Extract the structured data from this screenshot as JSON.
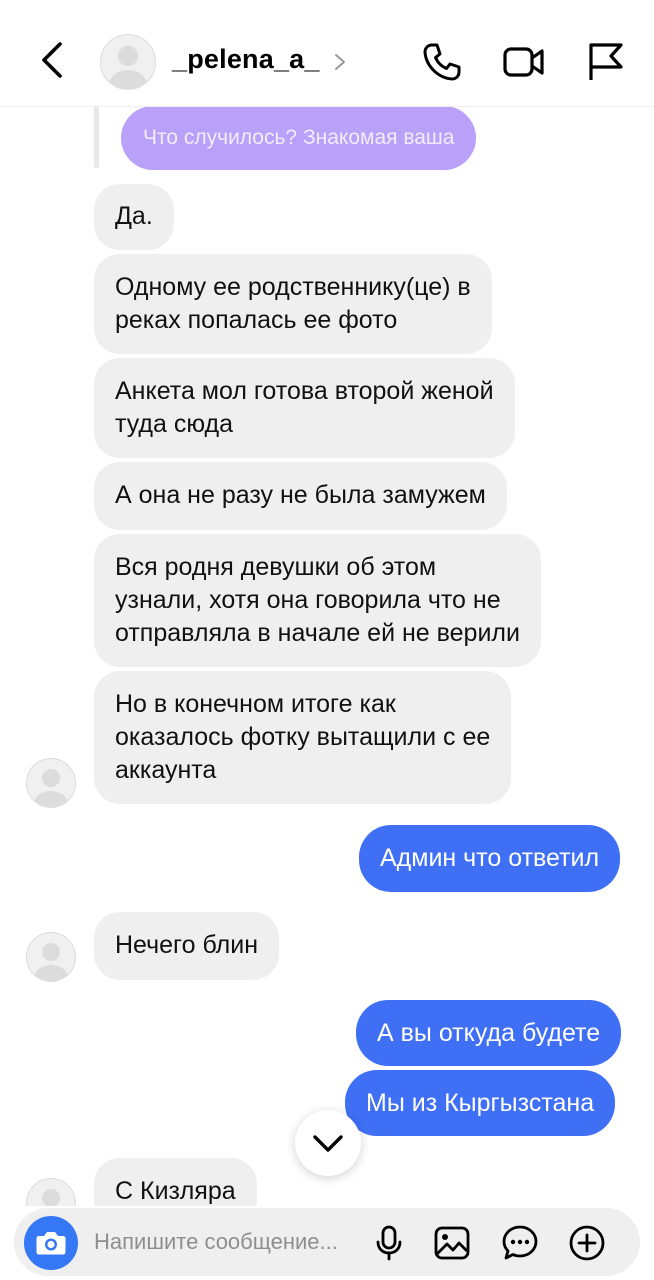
{
  "header": {
    "username": "_pelena_a_",
    "back_icon": "chevron-left-icon",
    "call_icon": "phone-icon",
    "video_icon": "video-camera-icon",
    "report_icon": "flag-icon"
  },
  "replied_message": "Что случилось? Знакомая ваша",
  "messages": [
    {
      "from": "them",
      "lines": [
        "Да."
      ]
    },
    {
      "from": "them",
      "lines": [
        "Одному ее родственнику(це) в",
        "реках попалась ее фото"
      ]
    },
    {
      "from": "them",
      "lines": [
        "Анкета мол готова второй женой",
        "туда сюда"
      ]
    },
    {
      "from": "them",
      "lines": [
        "А она не разу не была замужем"
      ]
    },
    {
      "from": "them",
      "lines": [
        "Вся родня девушки об этом",
        "узнали, хотя она говорила что не",
        "отправляла в начале ей не верили"
      ]
    },
    {
      "from": "them",
      "lines": [
        "Но в конечном итоге как",
        "оказалось фотку вытащили с ее",
        "аккаунта"
      ]
    },
    {
      "from": "me",
      "lines": [
        "Админ что ответил"
      ]
    },
    {
      "from": "them",
      "lines": [
        "Нечего блин"
      ]
    },
    {
      "from": "me",
      "lines": [
        "А вы откуда будете"
      ]
    },
    {
      "from": "me",
      "lines": [
        "Мы из Кыргызстана"
      ]
    },
    {
      "from": "them",
      "lines": [
        "С Кизляра"
      ]
    }
  ],
  "composer": {
    "placeholder": "Напишите сообщение...",
    "camera_icon": "camera-icon",
    "mic_icon": "microphone-icon",
    "gallery_icon": "image-icon",
    "sticker_icon": "chat-sticker-icon",
    "plus_icon": "plus-circle-icon"
  },
  "colors": {
    "incoming_bubble": "#efeff0",
    "outgoing_bubble": "#3f6ff5",
    "replied_bubble": "#b9a0f8",
    "camera_button": "#3478f6"
  }
}
